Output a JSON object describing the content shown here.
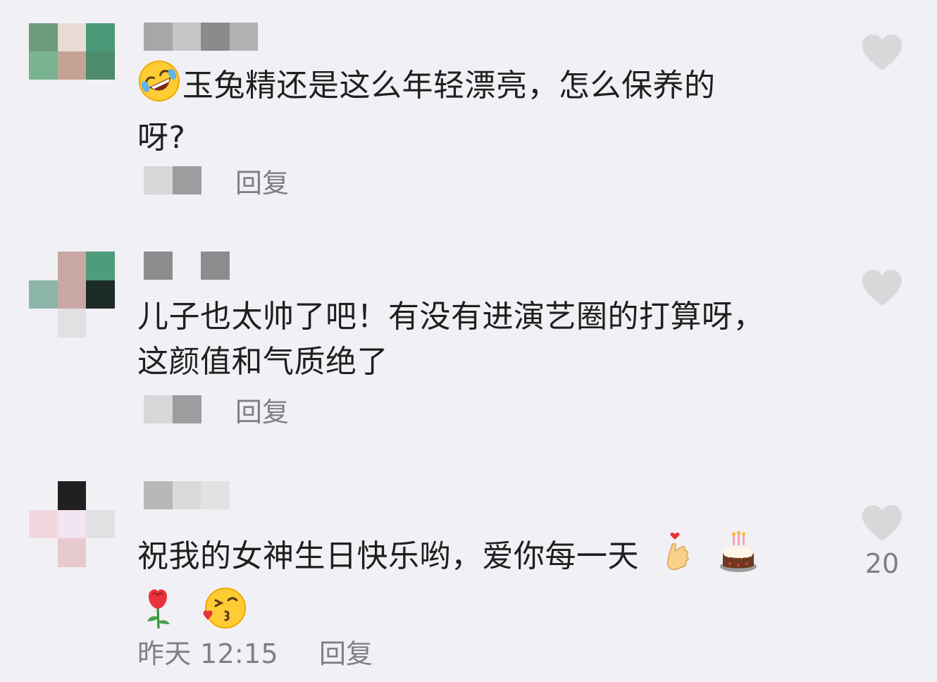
{
  "comments": [
    {
      "text_line1": "玉兔精还是这么年轻漂亮，怎么保养的",
      "text_line2": "呀?",
      "emoji_lead": "rolling-on-floor-laughing",
      "reply_label": "回复",
      "avatar_colors": [
        "#6e9a7e",
        "#e8dcd5",
        "#4a9877",
        "#79b391",
        "#c5a394",
        "#4e8a6c"
      ],
      "name_blur_colors": [
        "#a7a7a9",
        "#c6c6c8",
        "#8b8b8d",
        "#b1b1b3"
      ],
      "meta_blur_colors": [
        "#d7d7d9",
        "#9d9d9f"
      ]
    },
    {
      "text_line1": "儿子也太帅了吧！有没有进演艺圈的打算呀，",
      "text_line2": "这颜值和气质绝了",
      "reply_label": "回复",
      "avatar_colors": [
        "#f1f0f5",
        "#c9a7a4",
        "#4e9c7c",
        "#8bb5a9",
        "#c9a7a4",
        "#1c2b24",
        "#f1f0f5",
        "#e1e0e3",
        "#f1f0f5"
      ],
      "name_blur_colors": [
        "#8c8c8e",
        "#f1f0f5",
        "#8c8c8e"
      ],
      "meta_blur_colors": [
        "#d7d7d9",
        "#9d9d9f"
      ]
    },
    {
      "text_line1": "祝我的女神生日快乐哟，爱你每一天",
      "emojis_line1": [
        "hand-with-heart",
        "birthday-cake"
      ],
      "emojis_line2": [
        "rose",
        "face-blowing-kiss"
      ],
      "timestamp": "昨天 12:15",
      "reply_label": "回复",
      "like_count": "20",
      "avatar_colors": [
        "#f1f0f5",
        "#1f1f1f",
        "#f1f0f5",
        "#f1d8df",
        "#f3e4f1",
        "#e1e0e3",
        "#f1f0f5",
        "#e7c9d0",
        "#f1f0f5"
      ],
      "name_blur_colors": [
        "#b8b8ba",
        "#dadadc",
        "#e2e2e4"
      ]
    }
  ],
  "colors": {
    "background": "#f1f0f5",
    "text": "#1f1f1f",
    "secondary_text": "#7f7f83",
    "heart": "#d8d8da"
  },
  "icons": {
    "like": "heart-icon"
  }
}
